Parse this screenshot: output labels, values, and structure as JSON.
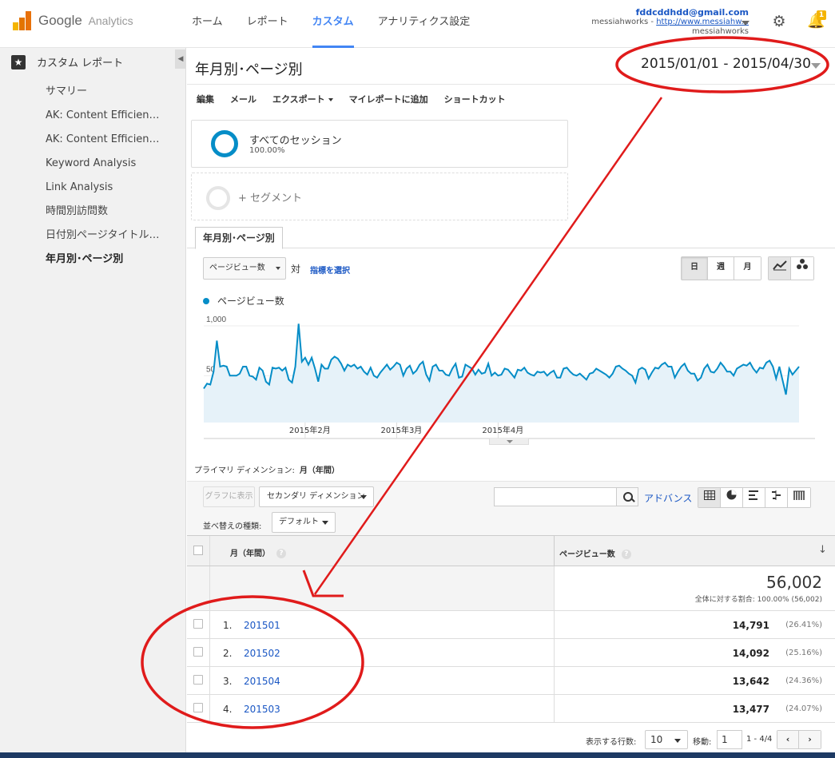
{
  "header": {
    "logo_brand": "Google",
    "logo_product": "Analytics",
    "nav": [
      {
        "label": "ホーム"
      },
      {
        "label": "レポート"
      },
      {
        "label": "カスタム"
      },
      {
        "label": "アナリティクス設定"
      }
    ],
    "account": {
      "email": "fddcddhdd@gmail.com",
      "site_prefix": "messiahworks - ",
      "site_link": "http://www.messiahw...",
      "site_name": "messiahworks"
    },
    "notification_count": "1"
  },
  "sidebar": {
    "title": "カスタム レポート",
    "items": [
      {
        "label": "サマリー"
      },
      {
        "label": "AK: Content Efficiency..."
      },
      {
        "label": "AK: Content Efficiency..."
      },
      {
        "label": "Keyword Analysis"
      },
      {
        "label": "Link Analysis"
      },
      {
        "label": "時間別訪問数"
      },
      {
        "label": "日付別ページタイトル別..."
      },
      {
        "label": "年月別･ページ別"
      }
    ]
  },
  "report": {
    "title": "年月別･ページ別",
    "date_range": "2015/01/01 - 2015/04/30",
    "toolbar": {
      "edit": "編集",
      "email": "メール",
      "export": "エクスポート",
      "add_to_dashboard": "マイレポートに追加",
      "shortcut": "ショートカット"
    },
    "segment": {
      "name": "すべてのセッション",
      "pct": "100.00%",
      "add_label": "+ セグメント"
    },
    "tab_label": "年月別･ページ別",
    "metric_select": "ページビュー数",
    "vs_label": "対",
    "pick_metric": "指標を選択",
    "periods": {
      "day": "日",
      "week": "週",
      "month": "月"
    },
    "legend_label": "ページビュー数",
    "primary_dimension_label": "プライマリ ディメンション:",
    "primary_dimension_value": "月（年間）",
    "plot_rows": "グラフに表示",
    "secondary_dimension": "セカンダリ ディメンション",
    "search_placeholder": "",
    "advanced": "アドバンス",
    "sort_label": "並べ替えの種類:",
    "sort_value": "デフォルト"
  },
  "chart_data": {
    "type": "line",
    "title": "",
    "series": [
      {
        "name": "ページビュー数",
        "values": [
          340,
          390,
          380,
          510,
          820,
          560,
          570,
          560,
          470,
          470,
          470,
          490,
          560,
          560,
          470,
          460,
          430,
          550,
          520,
          410,
          380,
          550,
          540,
          550,
          520,
          550,
          430,
          400,
          560,
          990,
          610,
          650,
          580,
          650,
          540,
          410,
          580,
          540,
          540,
          630,
          660,
          640,
          590,
          520,
          580,
          560,
          580,
          540,
          560,
          510,
          480,
          550,
          470,
          450,
          500,
          540,
          580,
          530,
          560,
          600,
          580,
          470,
          540,
          570,
          490,
          520,
          580,
          610,
          480,
          420,
          560,
          580,
          520,
          520,
          480,
          470,
          540,
          590,
          450,
          460,
          580,
          560,
          540,
          480,
          530,
          490,
          500,
          590,
          470,
          500,
          470,
          480,
          540,
          530,
          490,
          450,
          530,
          520,
          550,
          500,
          480,
          470,
          510,
          500,
          510,
          470,
          500,
          520,
          450,
          450,
          540,
          550,
          510,
          480,
          470,
          490,
          460,
          430,
          490,
          500,
          540,
          520,
          500,
          480,
          450,
          490,
          560,
          570,
          540,
          520,
          490,
          470,
          400,
          530,
          550,
          530,
          440,
          500,
          550,
          540,
          580,
          600,
          560,
          560,
          450,
          510,
          560,
          590,
          520,
          490,
          490,
          420,
          450,
          540,
          580,
          510,
          500,
          540,
          600,
          560,
          510,
          510,
          470,
          540,
          560,
          580,
          570,
          600,
          540,
          500,
          550,
          540,
          600,
          620,
          560,
          440,
          560,
          420,
          280,
          540,
          480,
          520,
          560
        ]
      }
    ],
    "ylim": [
      0,
      1000
    ],
    "y_ticks": [
      "1,000",
      "500"
    ],
    "x_ticks": [
      "2015年2月",
      "2015年3月",
      "2015年4月"
    ],
    "grid": true,
    "line_color": "#058dc7"
  },
  "table": {
    "col_dimension": "月（年間）",
    "col_metric": "ページビュー数",
    "summary_total": "56,002",
    "summary_sub": "全体に対する割合: 100.00% (56,002)",
    "rows": [
      {
        "idx": "1.",
        "dim": "201501",
        "value": "14,791",
        "pct": "(26.41%)"
      },
      {
        "idx": "2.",
        "dim": "201502",
        "value": "14,092",
        "pct": "(25.16%)"
      },
      {
        "idx": "3.",
        "dim": "201504",
        "value": "13,642",
        "pct": "(24.36%)"
      },
      {
        "idx": "4.",
        "dim": "201503",
        "value": "13,477",
        "pct": "(24.07%)"
      }
    ]
  },
  "pager": {
    "rows_label": "表示する行数:",
    "rows_value": "10",
    "goto_label": "移動:",
    "goto_value": "1",
    "range": "1 - 4/4"
  },
  "colors": {
    "accent": "#4285f4",
    "series": "#058dc7",
    "annotation": "#e01b1b"
  }
}
